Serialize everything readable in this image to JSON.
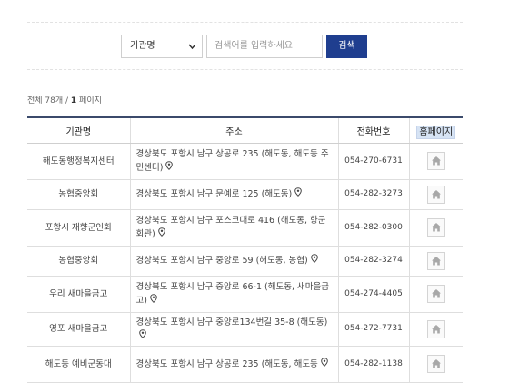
{
  "search": {
    "select_value": "기관명",
    "input_placeholder": "검색어를 입력하세요",
    "button_label": "검색"
  },
  "summary": {
    "prefix": "전체 78개 / ",
    "page": "1",
    "suffix": " 페이지"
  },
  "table": {
    "headers": [
      "기관명",
      "주소",
      "전화번호",
      "홈페이지"
    ],
    "rows": [
      {
        "name": "해도동행정복지센터",
        "address": "경상북도 포항시 남구 상공로 235 (해도동, 해도동 주민센터)",
        "tel": "054-270-6731"
      },
      {
        "name": "농협중앙회",
        "address": "경상북도 포항시 남구 문예로 125 (해도동)",
        "tel": "054-282-3273"
      },
      {
        "name": "포항시 재향군인회",
        "address": "경상북도 포항시 남구 포스코대로 416 (해도동, 향군회관)",
        "tel": "054-282-0300"
      },
      {
        "name": "농협중앙회",
        "address": "경상북도 포항시 남구 중앙로 59 (해도동, 농협)",
        "tel": "054-282-3274"
      },
      {
        "name": "우리 새마을금고",
        "address": "경상북도 포항시 남구 중앙로 66-1 (해도동, 새마을금고)",
        "tel": "054-274-4405"
      },
      {
        "name": "영포 새마을금고",
        "address": "경상북도 포항시 남구 중앙로134번길 35-8 (해도동)",
        "tel": "054-272-7731"
      },
      {
        "name": "해도동 예비군동대",
        "address": "경상북도 포항시 남구 상공로 235 (해도동, 해도동",
        "tel": "054-282-1138"
      }
    ]
  }
}
